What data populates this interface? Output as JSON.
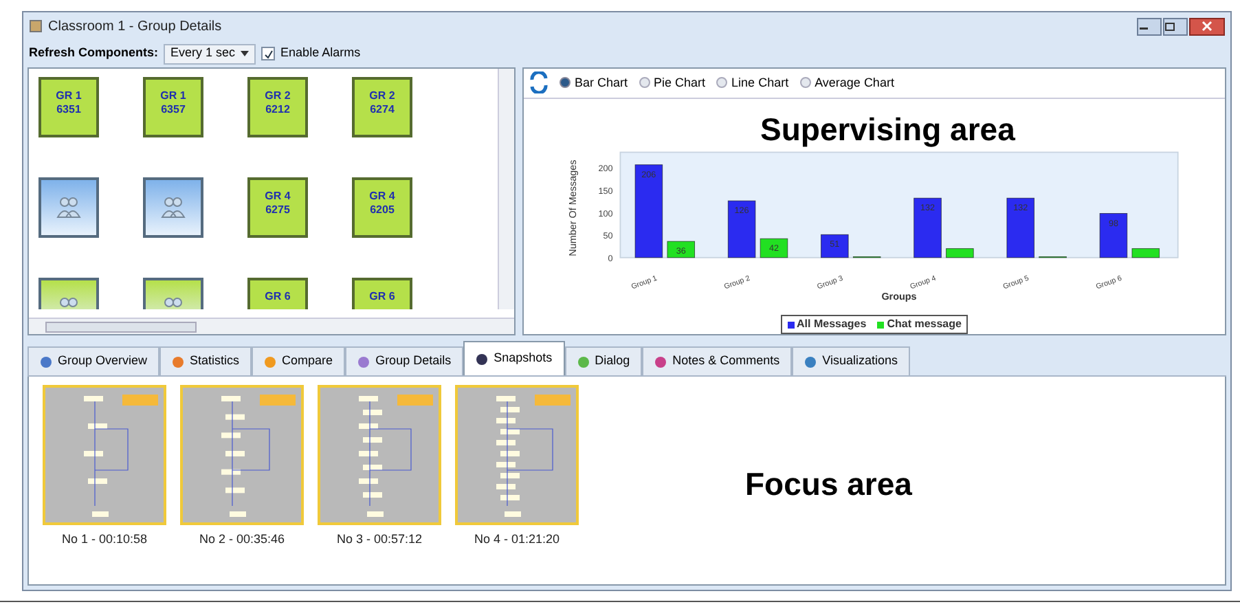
{
  "window": {
    "title": "Classroom 1 - Group Details"
  },
  "toolbar": {
    "refresh_label": "Refresh Components:",
    "refresh_value": "Every 1 sec",
    "alarms": {
      "label": "Enable Alarms",
      "checked": true
    }
  },
  "tiles": [
    {
      "kind": "text",
      "lines": [
        "GR 1",
        "6351"
      ]
    },
    {
      "kind": "text",
      "lines": [
        "GR 1",
        "6357"
      ]
    },
    {
      "kind": "text",
      "lines": [
        "GR 2",
        "6212"
      ]
    },
    {
      "kind": "text",
      "lines": [
        "GR 2",
        "6274"
      ]
    },
    {
      "kind": "figures",
      "color": "#7fb2ea"
    },
    {
      "kind": "figures",
      "color": "#7fb2ea"
    },
    {
      "kind": "text",
      "lines": [
        "GR 4",
        "6275"
      ]
    },
    {
      "kind": "text",
      "lines": [
        "GR 4",
        "6205"
      ]
    },
    {
      "kind": "figures",
      "color": "#b5e04a"
    },
    {
      "kind": "figures",
      "color": "#b5e04a"
    },
    {
      "kind": "text",
      "lines": [
        "GR 6"
      ]
    },
    {
      "kind": "text",
      "lines": [
        "GR 6"
      ]
    }
  ],
  "chart_types": [
    {
      "label": "Bar Chart",
      "selected": true
    },
    {
      "label": "Pie Chart",
      "selected": false
    },
    {
      "label": "Line Chart",
      "selected": false
    },
    {
      "label": "Average Chart",
      "selected": false
    }
  ],
  "chart_data": {
    "type": "bar",
    "xlabel": "Groups",
    "ylabel": "Number Of Messages",
    "categories": [
      "Group 1",
      "Group 2",
      "Group 3",
      "Group 4",
      "Group 5",
      "Group 6"
    ],
    "ylim": [
      0,
      220
    ],
    "yticks": [
      0,
      50,
      100,
      150,
      200
    ],
    "series": [
      {
        "name": "All Messages",
        "color": "#2b2bf0",
        "values": [
          206,
          126,
          51,
          132,
          132,
          98
        ],
        "value_labels": [
          "206",
          "126",
          "51",
          "132",
          "132",
          "98"
        ]
      },
      {
        "name": "Chat message",
        "color": "#22e022",
        "values": [
          36,
          42,
          2,
          20,
          2,
          20
        ],
        "value_labels": [
          "36",
          "42",
          null,
          null,
          null,
          null
        ]
      }
    ]
  },
  "tabs": [
    {
      "label": "Group Overview",
      "selected": false
    },
    {
      "label": "Statistics",
      "selected": false
    },
    {
      "label": "Compare",
      "selected": false
    },
    {
      "label": "Group Details",
      "selected": false
    },
    {
      "label": "Snapshots",
      "selected": true
    },
    {
      "label": "Dialog",
      "selected": false
    },
    {
      "label": "Notes & Comments",
      "selected": false
    },
    {
      "label": "Visualizations",
      "selected": false
    }
  ],
  "snapshots": [
    {
      "caption": "No 1 - 00:10:58"
    },
    {
      "caption": "No 2 - 00:35:46"
    },
    {
      "caption": "No 3 - 00:57:12"
    },
    {
      "caption": "No 4 - 01:21:20"
    }
  ],
  "annotations": [
    "Supervising area",
    "Focus area"
  ]
}
